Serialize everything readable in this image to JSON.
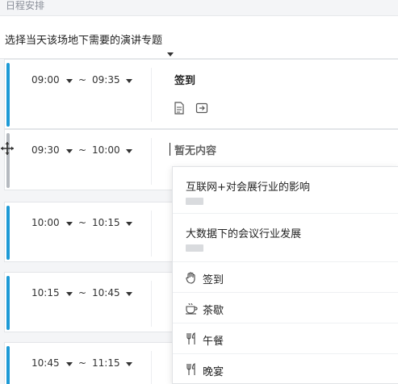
{
  "header": {
    "title": "日程安排"
  },
  "topic_select": {
    "label": "选择当天该场地下需要的演讲专题"
  },
  "time_separator": "~",
  "sessions": [
    {
      "start": "09:00",
      "end": "09:35",
      "title": "签到",
      "bar_color": "#1d9ad6"
    },
    {
      "start": "09:30",
      "end": "10:00",
      "title": "暂无内容",
      "bar_color": "#b5b9bf"
    },
    {
      "start": "10:00",
      "end": "10:15",
      "title": "",
      "bar_color": "#1d9ad6"
    },
    {
      "start": "10:15",
      "end": "10:45",
      "title": "",
      "bar_color": "#1d9ad6"
    },
    {
      "start": "10:45",
      "end": "11:15",
      "title": "",
      "bar_color": "#1d9ad6"
    }
  ],
  "dropdown": {
    "topics": [
      {
        "name": "互联网+对会展行业的影响"
      },
      {
        "name": "大数据下的会议行业发展"
      }
    ],
    "types": [
      {
        "label": "签到",
        "icon": "hand-icon"
      },
      {
        "label": "茶歇",
        "icon": "coffee-cup-icon"
      },
      {
        "label": "午餐",
        "icon": "fork-knife-icon"
      },
      {
        "label": "晚宴",
        "icon": "fork-knife-icon"
      }
    ]
  }
}
